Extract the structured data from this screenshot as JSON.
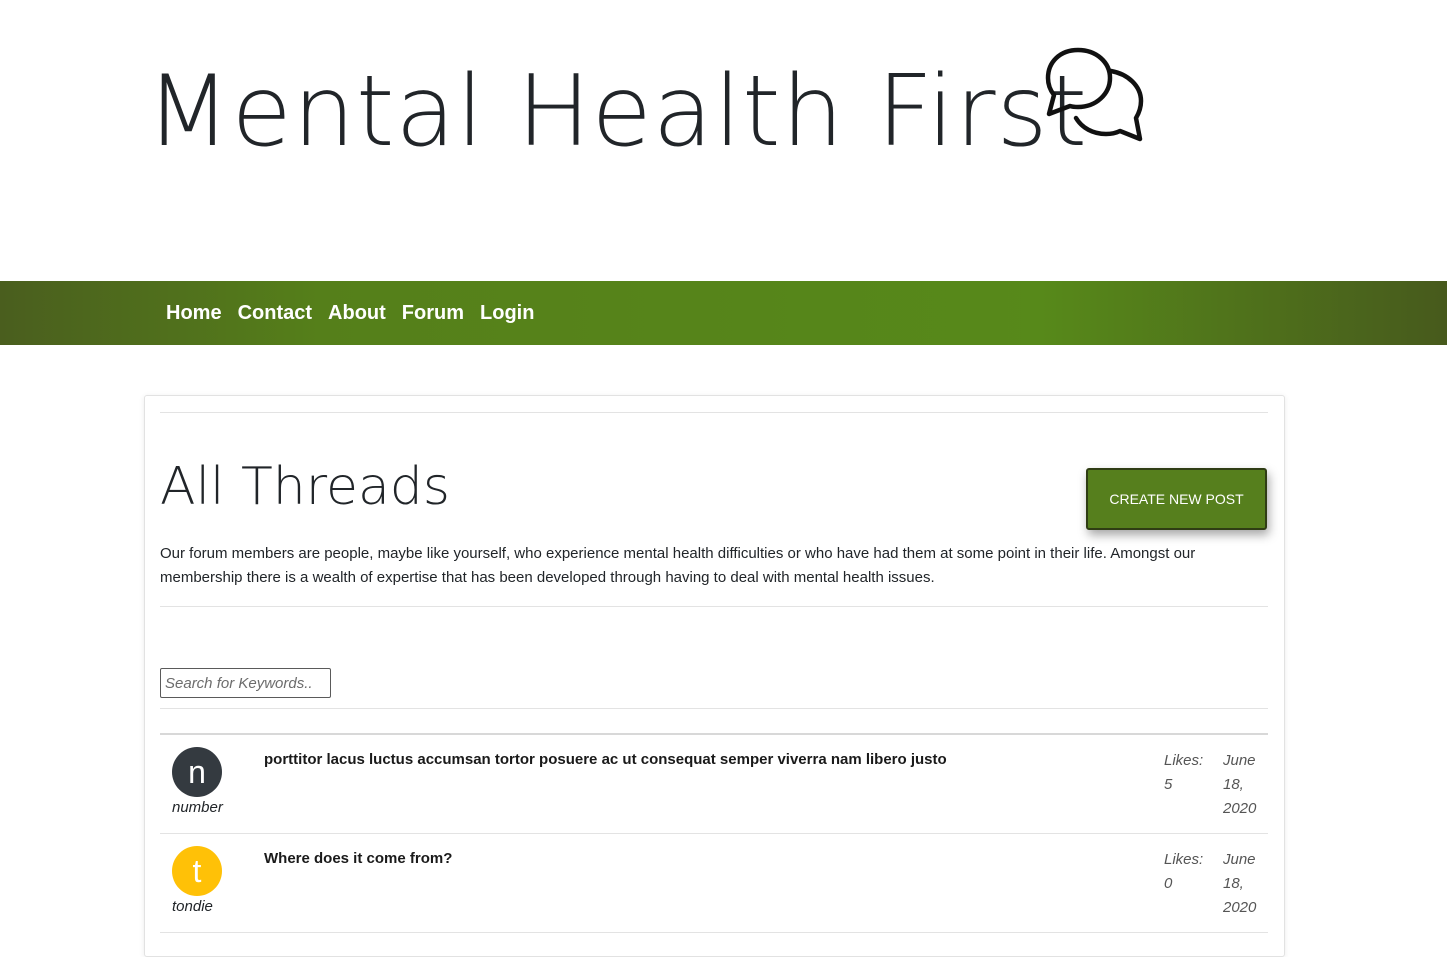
{
  "site": {
    "title": "Mental Health First",
    "logo_icon": "chat-bubbles-icon"
  },
  "nav": {
    "items": [
      {
        "label": "Home"
      },
      {
        "label": "Contact"
      },
      {
        "label": "About"
      },
      {
        "label": "Forum"
      },
      {
        "label": "Login"
      }
    ]
  },
  "colors": {
    "nav_green": "#57891a",
    "button_green": "#567f1d",
    "avatar_dark": "#343a40",
    "avatar_yellow": "#ffc107"
  },
  "main": {
    "heading": "All Threads",
    "create_button": "CREATE NEW POST",
    "intro": "Our forum members are people, maybe like yourself, who experience mental health difficulties or who have had them at some point in their life. Amongst our membership there is a wealth of expertise that has been developed through having to deal with mental health issues.",
    "search_placeholder": "Search for Keywords.."
  },
  "threads": [
    {
      "avatar_letter": "n",
      "avatar_color": "#343a40",
      "username": "number",
      "title": "porttitor lacus luctus accumsan tortor posuere ac ut consequat semper viverra nam libero justo",
      "likes_label": "Likes:",
      "likes": "5",
      "date_month": "June",
      "date_day": "18,",
      "date_year": "2020"
    },
    {
      "avatar_letter": "t",
      "avatar_color": "#ffc107",
      "username": "tondie",
      "title": "Where does it come from?",
      "likes_label": "Likes:",
      "likes": "0",
      "date_month": "June",
      "date_day": "18,",
      "date_year": "2020"
    }
  ]
}
